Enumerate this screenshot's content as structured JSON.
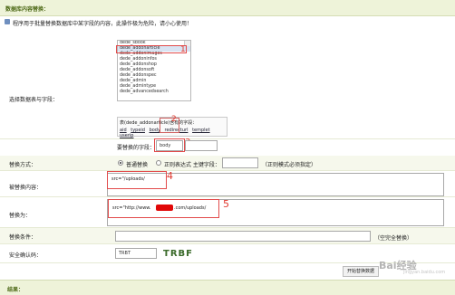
{
  "header": {
    "title": "数据库内容替换："
  },
  "notice": {
    "text": "程序用于批量替换数据库中某字段的内容，此操作极为危险，请小心使用！"
  },
  "form": {
    "table_label": "选择数据表与字段：",
    "tables": [
      "dede_sbook",
      "dede_addonarticle",
      "dede_addonimages",
      "dede_addoninfos",
      "dede_addonshop",
      "dede_addonsoft",
      "dede_addonspec",
      "dede_admin",
      "dede_admintype",
      "dede_advancedsearch"
    ],
    "selected_table": "dede_addonarticle",
    "fields_title": "表(dede_addonarticle)含有的字段：",
    "fields": [
      "aid",
      "typeid",
      "body",
      "redirecturl",
      "templet",
      "userip"
    ],
    "field_label": "要替换的字段：",
    "field_value": "body",
    "mode_label": "替换方式：",
    "mode_normal": "普通替换",
    "mode_regex": "正则表达式 主键字段：",
    "mode_regex_note": "（正则模式必须指定）",
    "replace_from_label": "被替换内容：",
    "replace_from_value": "src=\"/uploads/",
    "replace_to_label": "替换为：",
    "replace_to_prefix": "src=\"http://www.",
    "replace_to_suffix": ".com/uploads/",
    "condition_label": "替换条件：",
    "condition_note": "（空完全替换）",
    "captcha_label": "安全确认码：",
    "captcha_value": "TRBT",
    "captcha_image_text": "TRBF",
    "submit_label": "开始替换数据"
  },
  "annotations": {
    "n1": "1",
    "n2": "2",
    "n3": "3",
    "n4": "4",
    "n5": "5"
  },
  "footer": {
    "title": "结果："
  },
  "watermark": {
    "brand": "Bai经验",
    "url": "jingyan.baidu.com"
  }
}
